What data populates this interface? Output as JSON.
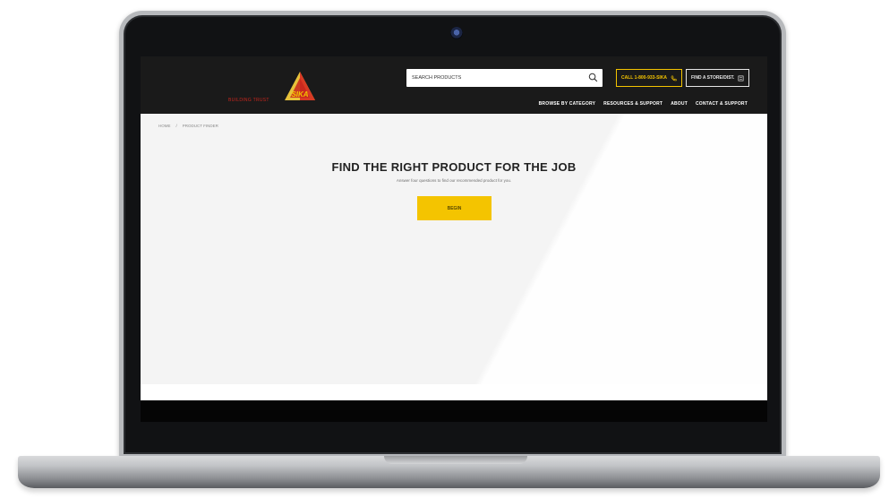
{
  "header": {
    "brand_tagline": "BUILDING TRUST",
    "logo_text": "SIKA",
    "search": {
      "placeholder": "SEARCH PRODUCTS"
    },
    "call_button": "CALL 1-800-933-SIKA",
    "find_store_button": "FIND A STORE/DIST."
  },
  "nav": {
    "items": [
      "BROWSE BY CATEGORY",
      "RESOURCES & SUPPORT",
      "ABOUT",
      "CONTACT & SUPPORT"
    ]
  },
  "breadcrumb": {
    "home": "HOME",
    "separator": "/",
    "current": "PRODUCT FINDER"
  },
  "main": {
    "title": "FIND THE RIGHT PRODUCT FOR THE JOB",
    "subtitle": "Answer four questions to find our recommended product for you.",
    "begin_button": "BEGIN"
  },
  "colors": {
    "accent_yellow": "#f4c400",
    "brand_red": "#c8261d",
    "header_bg": "#1a1a1a"
  },
  "icons": [
    "search-icon",
    "phone-icon",
    "location-icon",
    "sika-logo"
  ]
}
